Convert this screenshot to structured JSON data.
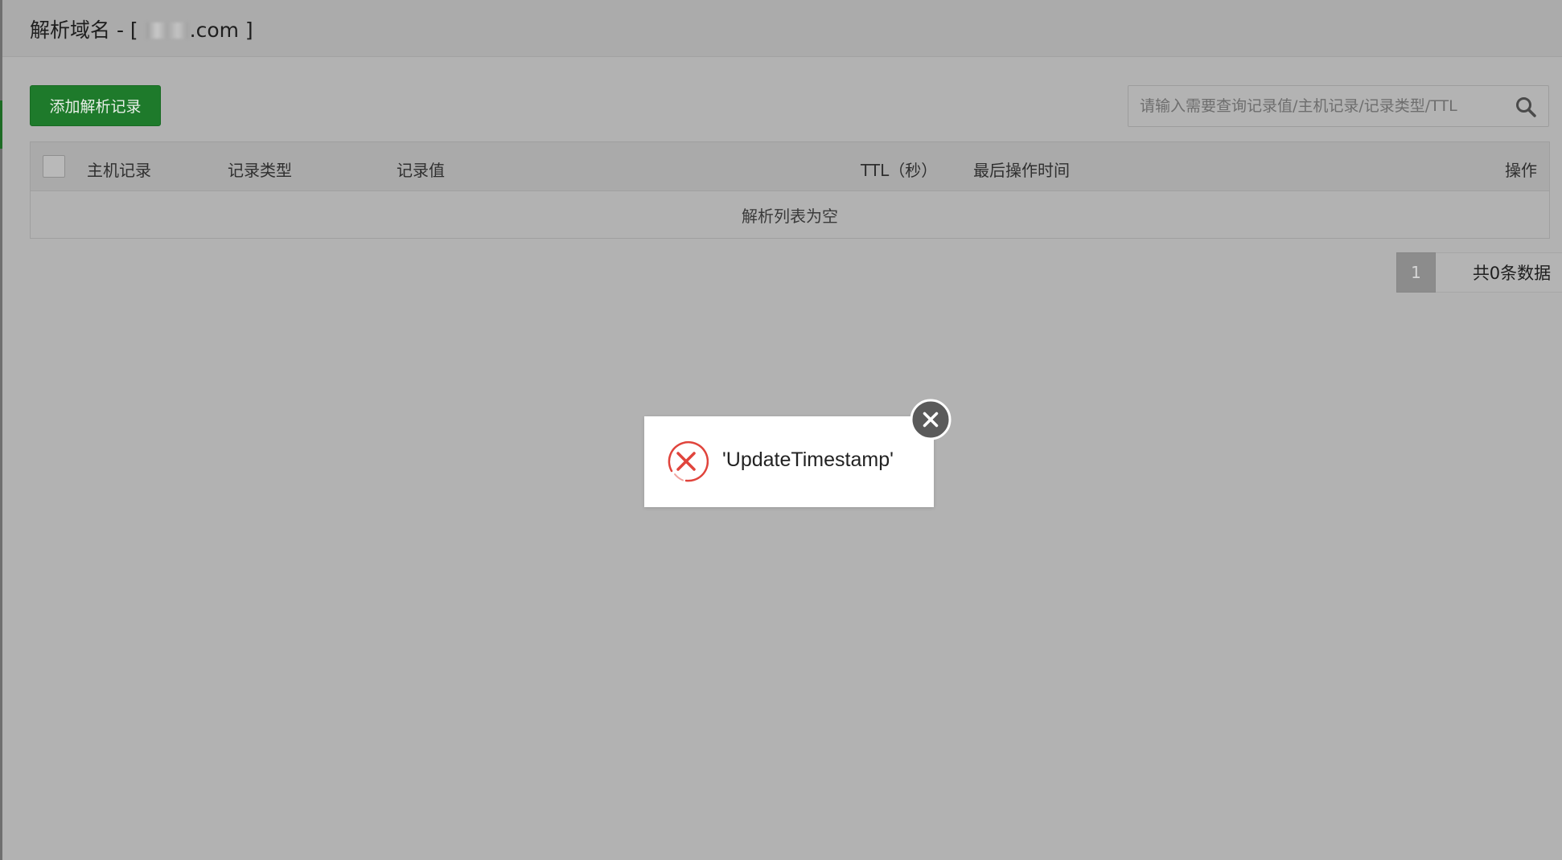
{
  "window": {
    "title_prefix": "解析域名 - [ ",
    "title_suffix": ".com ]"
  },
  "toolbar": {
    "add_record_label": "添加解析记录"
  },
  "search": {
    "placeholder": "请输入需要查询记录值/主机记录/记录类型/TTL",
    "icon": "search-icon"
  },
  "table": {
    "columns": [
      "主机记录",
      "记录类型",
      "记录值",
      "TTL（秒）",
      "最后操作时间",
      "操作"
    ],
    "empty_text": "解析列表为空"
  },
  "pagination": {
    "current_page": "1",
    "total_text": "共0条数据"
  },
  "toast": {
    "message": "'UpdateTimestamp'",
    "icon": "error-circle-x-icon",
    "close_icon": "close-icon"
  },
  "colors": {
    "overlay": "#b2b2b2",
    "primary_button": "#1e7a2b",
    "error": "#e0443c",
    "toast_bg": "#ffffff",
    "close_button": "#5a5a5a"
  }
}
